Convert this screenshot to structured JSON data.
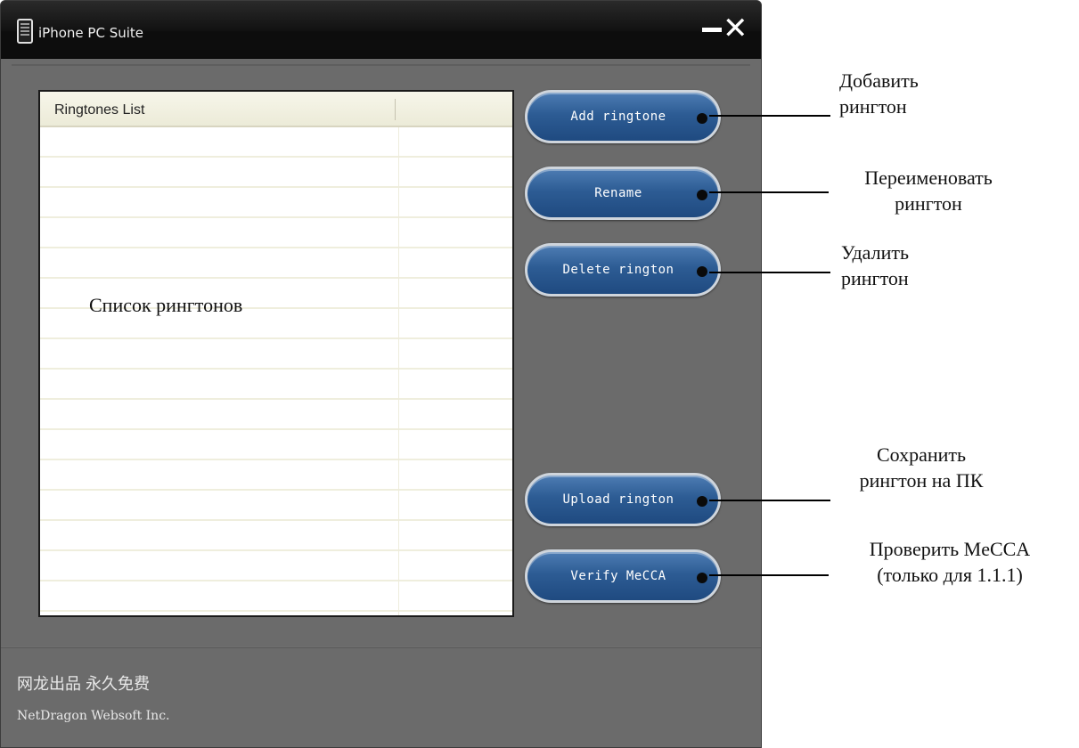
{
  "window": {
    "title": "iPhone PC Suite",
    "minimize_symbol": "",
    "close_symbol": "✕"
  },
  "list": {
    "header": "Ringtones List",
    "overlay_label": "Список рингтонов"
  },
  "buttons": {
    "add": "Add ringtone",
    "rename": "Rename",
    "delete": "Delete rington",
    "upload": "Upload rington",
    "verify": "Verify MeCCA"
  },
  "footer": {
    "line1": "网龙出品  永久免费",
    "line2": "NetDragon Websoft Inc."
  },
  "annotations": {
    "add_line1": "Добавить",
    "add_line2": "рингтон",
    "rename_line1": "Переименовать",
    "rename_line2": "рингтон",
    "delete_line1": "Удалить",
    "delete_line2": "рингтон",
    "upload_line1": "Сохранить",
    "upload_line2": "рингтон на ПК",
    "verify_line1": "Проверить MeCCA",
    "verify_line2": "(только для 1.1.1)"
  }
}
